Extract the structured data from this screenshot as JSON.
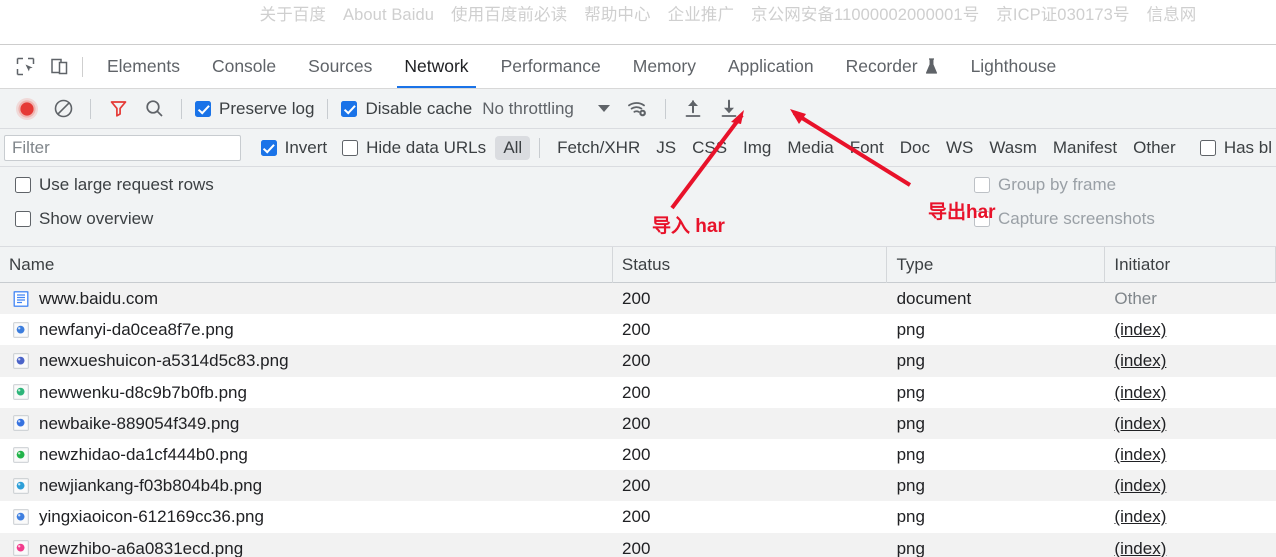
{
  "page_footer": {
    "links": [
      "关于百度",
      "About Baidu",
      "使用百度前必读",
      "帮助中心",
      "企业推广",
      "京公网安备11000002000001号",
      "京ICP证030173号",
      "信息网"
    ]
  },
  "devtools": {
    "left_icons": [
      {
        "name": "inspect-element-icon"
      },
      {
        "name": "device-toolbar-icon"
      }
    ],
    "tabs": [
      {
        "label": "Elements",
        "active": false,
        "badge": ""
      },
      {
        "label": "Console",
        "active": false,
        "badge": ""
      },
      {
        "label": "Sources",
        "active": false,
        "badge": ""
      },
      {
        "label": "Network",
        "active": true,
        "badge": ""
      },
      {
        "label": "Performance",
        "active": false,
        "badge": ""
      },
      {
        "label": "Memory",
        "active": false,
        "badge": ""
      },
      {
        "label": "Application",
        "active": false,
        "badge": ""
      },
      {
        "label": "Recorder",
        "active": false,
        "badge": "experiment-beaker-icon"
      },
      {
        "label": "Lighthouse",
        "active": false,
        "badge": ""
      }
    ],
    "toolbar": {
      "record_title": "record-button",
      "clear_title": "clear-button",
      "filter_title": "filter-funnel-icon",
      "search_title": "search-icon",
      "preserve_log": {
        "label": "Preserve log",
        "checked": true
      },
      "disable_cache": {
        "label": "Disable cache",
        "checked": true
      },
      "throttling": {
        "value": "No throttling"
      },
      "network_conditions_title": "network-conditions-icon",
      "import_har_title": "import-har-icon",
      "export_har_title": "export-har-icon"
    },
    "filterbar": {
      "filter_placeholder": "Filter",
      "filter_value": "",
      "invert": {
        "label": "Invert",
        "checked": true
      },
      "hide_data_urls": {
        "label": "Hide data URLs",
        "checked": false
      },
      "types": [
        {
          "label": "All",
          "selected": true
        },
        {
          "label": "Fetch/XHR",
          "selected": false
        },
        {
          "label": "JS",
          "selected": false
        },
        {
          "label": "CSS",
          "selected": false
        },
        {
          "label": "Img",
          "selected": false
        },
        {
          "label": "Media",
          "selected": false
        },
        {
          "label": "Font",
          "selected": false
        },
        {
          "label": "Doc",
          "selected": false
        },
        {
          "label": "WS",
          "selected": false
        },
        {
          "label": "Wasm",
          "selected": false
        },
        {
          "label": "Manifest",
          "selected": false
        },
        {
          "label": "Other",
          "selected": false
        }
      ],
      "has_blocked": {
        "label": "Has bl",
        "checked": false
      }
    },
    "settings": {
      "use_large_request_rows": {
        "label": "Use large request rows",
        "checked": false,
        "disabled": false
      },
      "show_overview": {
        "label": "Show overview",
        "checked": false,
        "disabled": false
      },
      "group_by_frame": {
        "label": "Group by frame",
        "checked": false,
        "disabled": true
      },
      "capture_screenshots": {
        "label": "Capture screenshots",
        "checked": false,
        "disabled": true
      }
    },
    "annotations": [
      {
        "text": "导入 har",
        "color": "#e8122a"
      },
      {
        "text": "导出har",
        "color": "#e8122a"
      }
    ],
    "table": {
      "columns": [
        "Name",
        "Status",
        "Type",
        "Initiator"
      ],
      "rows": [
        {
          "name": "www.baidu.com",
          "status": "200",
          "type": "document",
          "initiator": "Other",
          "initiator_link": false,
          "icon": "document-icon",
          "icon_color": "#4285f4"
        },
        {
          "name": "newfanyi-da0cea8f7e.png",
          "status": "200",
          "type": "png",
          "initiator": "(index)",
          "initiator_link": true,
          "icon": "image-thumb-icon",
          "icon_color": "#3b7ddd"
        },
        {
          "name": "newxueshuicon-a5314d5c83.png",
          "status": "200",
          "type": "png",
          "initiator": "(index)",
          "initiator_link": true,
          "icon": "image-thumb-icon",
          "icon_color": "#4a63c8"
        },
        {
          "name": "newwenku-d8c9b7b0fb.png",
          "status": "200",
          "type": "png",
          "initiator": "(index)",
          "initiator_link": true,
          "icon": "image-thumb-icon",
          "icon_color": "#2db57a"
        },
        {
          "name": "newbaike-889054f349.png",
          "status": "200",
          "type": "png",
          "initiator": "(index)",
          "initiator_link": true,
          "icon": "image-thumb-icon",
          "icon_color": "#3672e0"
        },
        {
          "name": "newzhidao-da1cf444b0.png",
          "status": "200",
          "type": "png",
          "initiator": "(index)",
          "initiator_link": true,
          "icon": "image-thumb-icon",
          "icon_color": "#21b34a"
        },
        {
          "name": "newjiankang-f03b804b4b.png",
          "status": "200",
          "type": "png",
          "initiator": "(index)",
          "initiator_link": true,
          "icon": "image-thumb-icon",
          "icon_color": "#2e9fd8"
        },
        {
          "name": "yingxiaoicon-612169cc36.png",
          "status": "200",
          "type": "png",
          "initiator": "(index)",
          "initiator_link": true,
          "icon": "image-thumb-icon",
          "icon_color": "#3f7fe0"
        },
        {
          "name": "newzhibo-a6a0831ecd.png",
          "status": "200",
          "type": "png",
          "initiator": "(index)",
          "initiator_link": true,
          "icon": "image-thumb-icon",
          "icon_color": "#f23c8c"
        }
      ]
    }
  }
}
